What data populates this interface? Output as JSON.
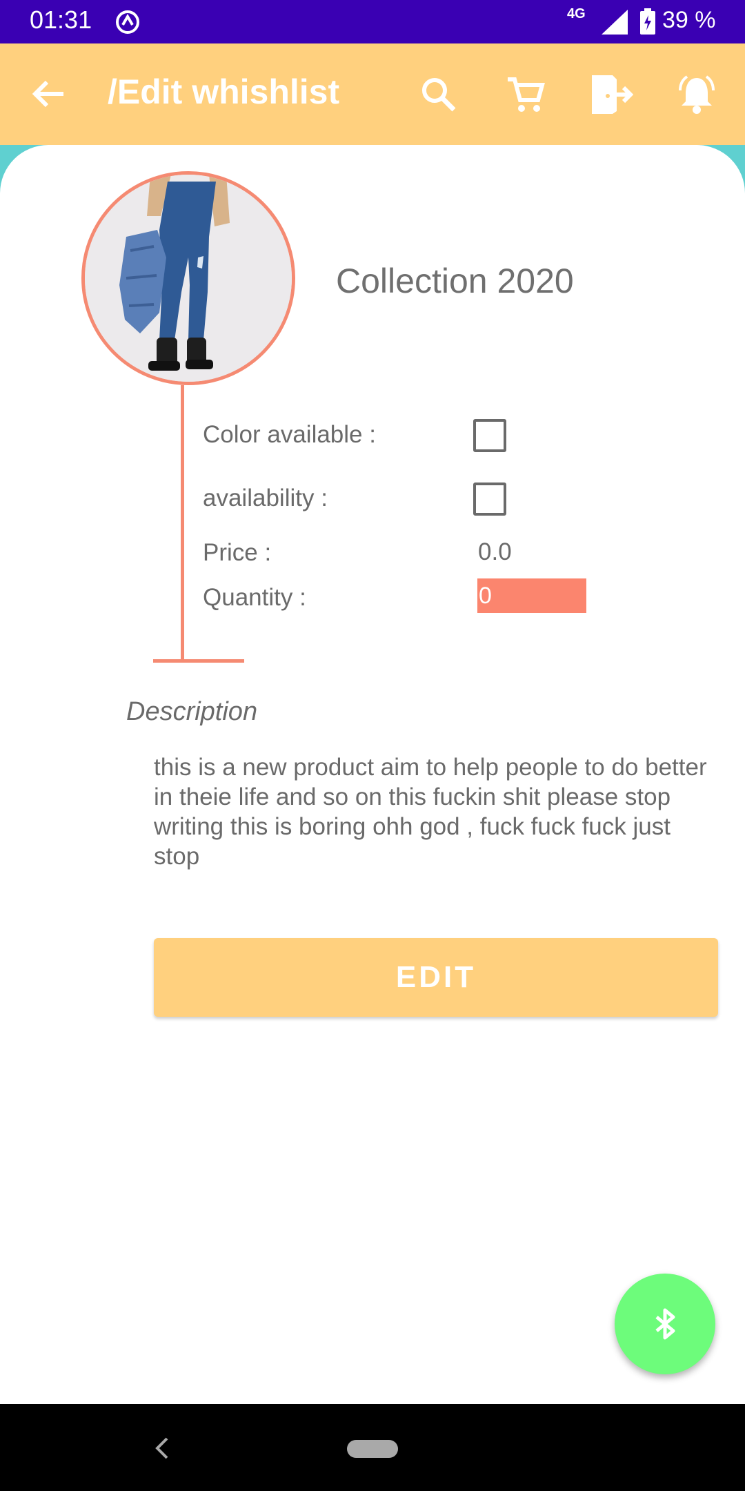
{
  "status_bar": {
    "time": "01:31",
    "network": "4G",
    "battery_percent": "39 %",
    "icons": [
      "sync-icon",
      "signal-icon",
      "battery-charging-icon"
    ]
  },
  "app_bar": {
    "title": "/Edit whishlist",
    "icons": [
      "back-arrow-icon",
      "search-icon",
      "cart-icon",
      "exit-icon",
      "notification-bell-icon"
    ],
    "background_color": "#ffd07e"
  },
  "product": {
    "collection_title": "Collection 2020",
    "image_alt": "product-photo-jeans",
    "fields": {
      "color_available_label": "Color available :",
      "color_available_checked": false,
      "availability_label": "availability :",
      "availability_checked": false,
      "price_label": "Price :",
      "price_value": "0.0",
      "quantity_label": "Quantity :",
      "quantity_value": "0"
    }
  },
  "description": {
    "heading": "Description",
    "text": "this is a new product aim to help people to do better in theie life and so on this fuckin shit please stop writing this is boring ohh god , fuck fuck fuck just stop"
  },
  "actions": {
    "edit_label": "EDIT",
    "fab_icon": "bluetooth-icon"
  },
  "colors": {
    "status_bar": "#3a00b3",
    "accent_salmon": "#f58a72",
    "fab_green": "#6dfc7b",
    "teal": "#5fd0d0"
  }
}
